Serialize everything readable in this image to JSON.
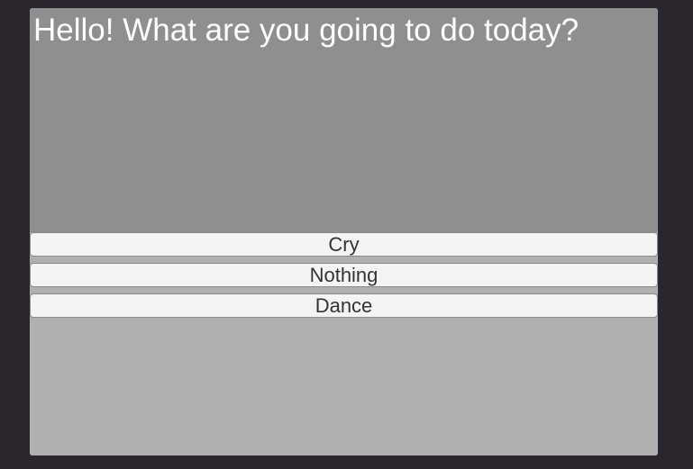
{
  "dialog": {
    "text": "Hello! What are you going to do today?"
  },
  "choices": [
    {
      "label": "Cry"
    },
    {
      "label": "Nothing"
    },
    {
      "label": "Dance"
    }
  ],
  "colors": {
    "background": "#2b262d",
    "dialog_panel": "#8f8f8f",
    "lower_panel": "#b0b0b0",
    "button_face": "#f4f4f4",
    "button_text": "#333333",
    "dialog_text": "#ffffff"
  }
}
